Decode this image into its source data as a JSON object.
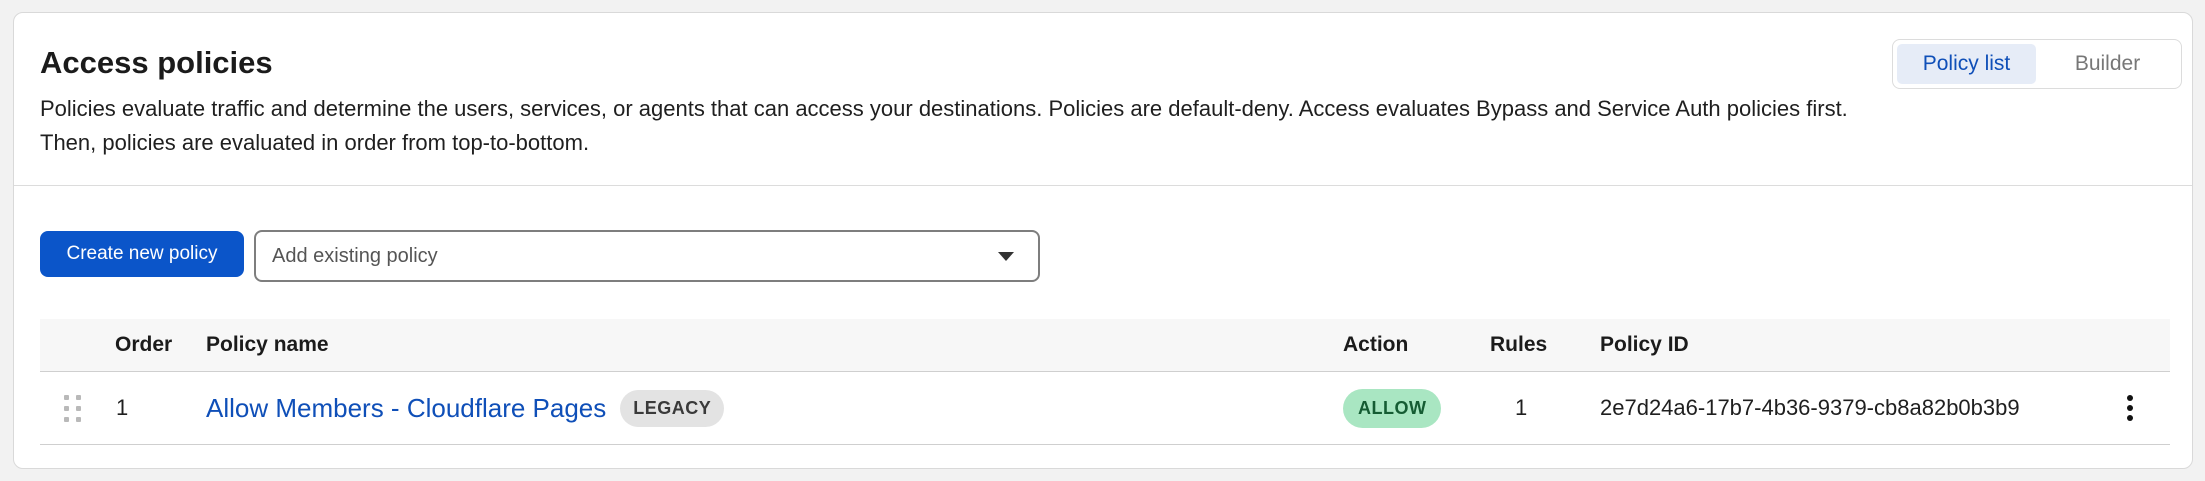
{
  "header": {
    "title": "Access policies",
    "description": "Policies evaluate traffic and determine the users, services, or agents that can access your destinations. Policies are default-deny. Access evaluates Bypass and Service Auth policies first. Then, policies are evaluated in order from top-to-bottom."
  },
  "view_toggle": {
    "options": [
      {
        "label": "Policy list",
        "active": true
      },
      {
        "label": "Builder",
        "active": false
      }
    ]
  },
  "actions": {
    "create_label": "Create new policy",
    "add_existing_placeholder": "Add existing policy"
  },
  "table": {
    "columns": {
      "order": "Order",
      "policy_name": "Policy name",
      "action": "Action",
      "rules": "Rules",
      "policy_id": "Policy ID"
    },
    "rows": [
      {
        "order": "1",
        "policy_name": "Allow Members - Cloudflare Pages",
        "badge": "LEGACY",
        "action": "ALLOW",
        "rules": "1",
        "policy_id": "2e7d24a6-17b7-4b36-9379-cb8a82b0b3b9"
      }
    ]
  },
  "colors": {
    "primary": "#0b55c9",
    "link": "#0f4fb8",
    "allow_badge_bg": "#a9e6c2",
    "legacy_badge_bg": "#e3e3e3"
  }
}
